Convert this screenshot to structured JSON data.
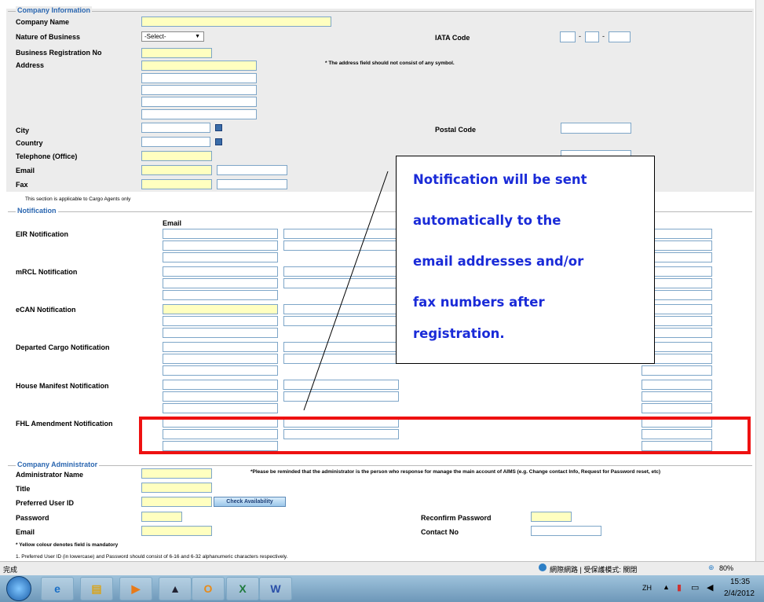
{
  "company_info": {
    "legend": "Company Information",
    "company_name_label": "Company Name",
    "nature_label": "Nature of Business",
    "nature_value": "-Select-",
    "iata_label": "IATA Code",
    "brn_label": "Business Registration No",
    "address_label": "Address",
    "address_note": "* The address field should not consist of any symbol.",
    "city_label": "City",
    "postal_label": "Postal Code",
    "country_label": "Country",
    "telephone_label": "Telephone (Office)",
    "email_label": "Email",
    "fax_label": "Fax",
    "cargo_note": "This section is applicable to Cargo Agents only"
  },
  "notification": {
    "legend": "Notification",
    "email_header": "Email",
    "rows": [
      "EIR Notification",
      "mRCL Notification",
      "eCAN Notification",
      "Departed Cargo Notification",
      "House Manifest Notification",
      "FHL Amendment Notification"
    ]
  },
  "callout": {
    "lines": [
      "Notification will be sent",
      "automatically to the",
      "email addresses and/or",
      "fax numbers after",
      "registration."
    ]
  },
  "admin": {
    "legend": "Company Administrator",
    "name_label": "Administrator Name",
    "reminder": "*Please be reminded that the administrator is the person who response for manage the main account of AIMS (e.g. Change contact Info, Request for Password reset, etc)",
    "title_label": "Title",
    "userid_label": "Preferred User ID",
    "check_button": "Check Availability",
    "password_label": "Password",
    "reconfirm_label": "Reconfirm Password",
    "email_label": "Email",
    "contact_label": "Contact No",
    "yellow_note": "* Yellow colour denotes field is mandatory",
    "note1": "1. Preferred User ID (in lowercase) and Password should consist of 6-16 and 6-32 alphanumeric characters respectively."
  },
  "statusbar": {
    "status": "完成",
    "zone": "網際網路 | 受保護模式: 關閉",
    "zoom": "80%"
  },
  "taskbar": {
    "lang": "ZH",
    "time": "15:35",
    "date": "2/4/2012"
  }
}
